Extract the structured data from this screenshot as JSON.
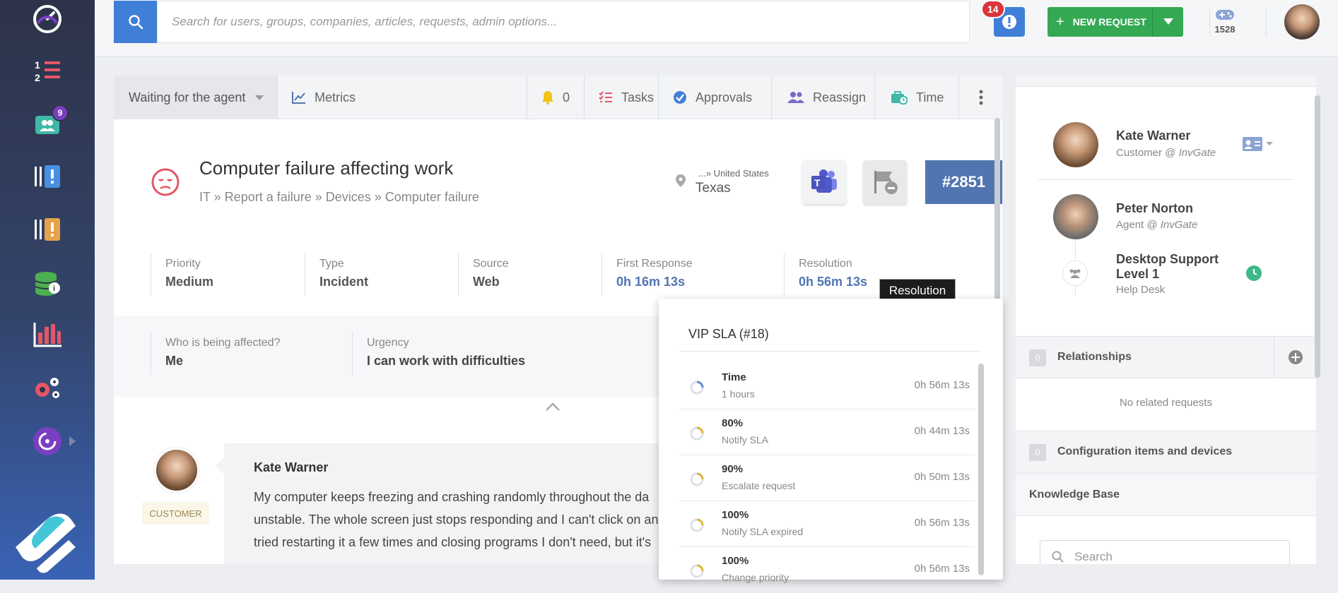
{
  "topbar": {
    "search_placeholder": "Search for users, groups, companies, articles, requests, admin options...",
    "alerts_count": "14",
    "new_request_label": "NEW REQUEST",
    "game_points": "1528"
  },
  "sidebar": {
    "groups_badge": "9"
  },
  "ticket": {
    "state": "Waiting for the agent",
    "metrics_label": "Metrics",
    "notifications_count": "0",
    "tasks_label": "Tasks",
    "approvals_label": "Approvals",
    "reassign_label": "Reassign",
    "time_label": "Time",
    "title": "Computer failure affecting work",
    "breadcrumb": "IT  »  Report a failure  »  Devices  »  Computer failure",
    "location_country": "...»  United States",
    "location_state": "Texas",
    "id": "#2851",
    "properties": [
      {
        "key": "Priority",
        "value": "Medium"
      },
      {
        "key": "Type",
        "value": "Incident"
      },
      {
        "key": "Source",
        "value": "Web"
      },
      {
        "key": "First Response",
        "value": "0h 16m 13s"
      },
      {
        "key": "Resolution",
        "value": "0h 56m 13s"
      }
    ],
    "fields": [
      {
        "key": "Who is being affected?",
        "value": "Me"
      },
      {
        "key": "Urgency",
        "value": "I can work with difficulties"
      }
    ],
    "message": {
      "author": "Kate Warner",
      "role_tag": "CUSTOMER",
      "text_lines": [
        "My computer keeps freezing and crashing randomly throughout the da",
        "unstable. The whole screen just stops responding and I can't click on an",
        "tried restarting it a few times and closing programs I don't need, but it's"
      ]
    }
  },
  "tooltip": "Resolution",
  "sla_popup": {
    "title": "VIP SLA (#18)",
    "rows": [
      {
        "name": "Time",
        "desc": "1 hours",
        "time": "0h 56m 13s",
        "color": "#5b8dd6"
      },
      {
        "name": "80%",
        "desc": "Notify SLA",
        "time": "0h 44m 13s",
        "color": "#e0b43a"
      },
      {
        "name": "90%",
        "desc": "Escalate request",
        "time": "0h 50m 13s",
        "color": "#e0b43a"
      },
      {
        "name": "100%",
        "desc": "Notify SLA expired",
        "time": "0h 56m 13s",
        "color": "#e0b43a"
      },
      {
        "name": "100%",
        "desc": "Change priority",
        "time": "0h 56m 13s",
        "color": "#e0b43a"
      }
    ]
  },
  "right_panel": {
    "customer_name": "Kate Warner",
    "customer_role": "Customer @ ",
    "customer_company": "InvGate",
    "agent_name": "Peter Norton",
    "agent_role": "Agent @ ",
    "agent_company": "InvGate",
    "group_name_line1": "Desktop Support",
    "group_name_line2": "Level 1",
    "group_desc": "Help Desk",
    "relationships_count": "0",
    "relationships_label": "Relationships",
    "no_related": "No related requests",
    "ci_count": "0",
    "ci_label": "Configuration items and devices",
    "kb_label": "Knowledge Base",
    "kb_search_placeholder": "Search"
  }
}
